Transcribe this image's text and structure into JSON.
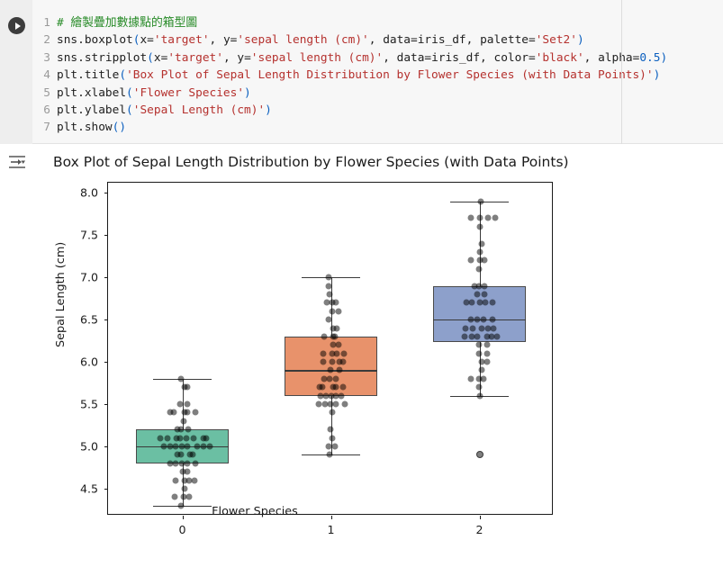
{
  "notebook": {
    "run_button_label": "run-cell",
    "output_icon_label": "output-toggle"
  },
  "code_cell": {
    "lines": [
      {
        "n": "1",
        "tokens": [
          {
            "t": "# 繪製疊加數據點的箱型圖",
            "c": "cmt"
          }
        ]
      },
      {
        "n": "2",
        "tokens": [
          {
            "t": "sns.boxplot",
            "c": "fn"
          },
          {
            "t": "(",
            "c": "par"
          },
          {
            "t": "x=",
            "c": "kw"
          },
          {
            "t": "'target'",
            "c": "str"
          },
          {
            "t": ", ",
            "c": "kw"
          },
          {
            "t": "y=",
            "c": "kw"
          },
          {
            "t": "'sepal length (cm)'",
            "c": "str"
          },
          {
            "t": ", ",
            "c": "kw"
          },
          {
            "t": "data=iris_df, ",
            "c": "kw"
          },
          {
            "t": "palette=",
            "c": "kw"
          },
          {
            "t": "'Set2'",
            "c": "str"
          },
          {
            "t": ")",
            "c": "par"
          }
        ]
      },
      {
        "n": "3",
        "tokens": [
          {
            "t": "sns.stripplot",
            "c": "fn"
          },
          {
            "t": "(",
            "c": "par"
          },
          {
            "t": "x=",
            "c": "kw"
          },
          {
            "t": "'target'",
            "c": "str"
          },
          {
            "t": ", ",
            "c": "kw"
          },
          {
            "t": "y=",
            "c": "kw"
          },
          {
            "t": "'sepal length (cm)'",
            "c": "str"
          },
          {
            "t": ", ",
            "c": "kw"
          },
          {
            "t": "data=iris_df, ",
            "c": "kw"
          },
          {
            "t": "color=",
            "c": "kw"
          },
          {
            "t": "'black'",
            "c": "str"
          },
          {
            "t": ", ",
            "c": "kw"
          },
          {
            "t": "alpha=",
            "c": "kw"
          },
          {
            "t": "0.5",
            "c": "num"
          },
          {
            "t": ")",
            "c": "par"
          }
        ]
      },
      {
        "n": "4",
        "tokens": [
          {
            "t": "plt.title",
            "c": "fn"
          },
          {
            "t": "(",
            "c": "par"
          },
          {
            "t": "'Box Plot of Sepal Length Distribution by Flower Species (with Data Points)'",
            "c": "str"
          },
          {
            "t": ")",
            "c": "par"
          }
        ]
      },
      {
        "n": "5",
        "tokens": [
          {
            "t": "plt.xlabel",
            "c": "fn"
          },
          {
            "t": "(",
            "c": "par"
          },
          {
            "t": "'Flower Species'",
            "c": "str"
          },
          {
            "t": ")",
            "c": "par"
          }
        ]
      },
      {
        "n": "6",
        "tokens": [
          {
            "t": "plt.ylabel",
            "c": "fn"
          },
          {
            "t": "(",
            "c": "par"
          },
          {
            "t": "'Sepal Length (cm)'",
            "c": "str"
          },
          {
            "t": ")",
            "c": "par"
          }
        ]
      },
      {
        "n": "7",
        "tokens": [
          {
            "t": "plt.show",
            "c": "fn"
          },
          {
            "t": "()",
            "c": "par"
          }
        ]
      }
    ]
  },
  "chart_data": {
    "type": "box",
    "title": "Box Plot of Sepal Length Distribution by Flower Species (with Data Points)",
    "xlabel": "Flower Species",
    "ylabel": "Sepal Length (cm)",
    "categories": [
      "0",
      "1",
      "2"
    ],
    "xtick_labels": [
      "0",
      "1",
      "2"
    ],
    "ytick_labels": [
      "8.0",
      "7.5",
      "7.0",
      "6.5",
      "6.0",
      "5.5",
      "5.0",
      "4.5"
    ],
    "ytick_values": [
      8.0,
      7.5,
      7.0,
      6.5,
      6.0,
      5.5,
      5.0,
      4.5
    ],
    "ylim": [
      4.18,
      8.12
    ],
    "grid": false,
    "legend": null,
    "colors": [
      "#6bbfa3",
      "#e8926b",
      "#8da0cb"
    ],
    "overlay": {
      "kind": "stripplot",
      "color": "#000000",
      "alpha": 0.5
    },
    "boxes": [
      {
        "category": "0",
        "color": "#6bbfa3",
        "q1": 4.8,
        "median": 5.0,
        "q3": 5.2,
        "whisker_low": 4.3,
        "whisker_high": 5.8,
        "fliers": [],
        "points": [
          5.1,
          4.9,
          4.7,
          4.6,
          5.0,
          5.4,
          4.6,
          5.0,
          4.4,
          4.9,
          5.4,
          4.8,
          4.8,
          4.3,
          5.8,
          5.7,
          5.4,
          5.1,
          5.7,
          5.1,
          5.4,
          5.1,
          4.6,
          5.1,
          4.8,
          5.0,
          5.0,
          5.2,
          5.2,
          4.7,
          4.8,
          5.4,
          5.2,
          5.5,
          4.9,
          5.0,
          5.5,
          4.9,
          4.4,
          5.1,
          5.0,
          4.5,
          4.4,
          5.0,
          5.1,
          4.8,
          5.1,
          4.6,
          5.3,
          5.0
        ]
      },
      {
        "category": "1",
        "color": "#e8926b",
        "q1": 5.6,
        "median": 5.9,
        "q3": 6.3,
        "whisker_low": 4.9,
        "whisker_high": 7.0,
        "fliers": [],
        "points": [
          7.0,
          6.4,
          6.9,
          5.5,
          6.5,
          5.7,
          6.3,
          4.9,
          6.6,
          5.2,
          5.0,
          5.9,
          6.0,
          6.1,
          5.6,
          6.7,
          5.6,
          5.8,
          6.2,
          5.6,
          5.9,
          6.1,
          6.3,
          6.1,
          6.4,
          6.6,
          6.8,
          6.7,
          6.0,
          5.7,
          5.5,
          5.5,
          5.8,
          6.0,
          5.4,
          6.0,
          6.7,
          6.3,
          5.6,
          5.5,
          5.5,
          6.1,
          5.8,
          5.0,
          5.6,
          5.7,
          5.7,
          6.2,
          5.1,
          5.7
        ]
      },
      {
        "category": "2",
        "color": "#8da0cb",
        "q1": 6.23,
        "median": 6.5,
        "q3": 6.9,
        "whisker_low": 5.6,
        "whisker_high": 7.9,
        "fliers": [
          4.9
        ],
        "points": [
          6.3,
          5.8,
          7.1,
          6.3,
          6.5,
          7.6,
          4.9,
          7.3,
          6.7,
          7.2,
          6.5,
          6.4,
          6.8,
          5.7,
          5.8,
          6.4,
          6.5,
          7.7,
          7.7,
          6.0,
          6.9,
          5.6,
          7.7,
          6.3,
          6.7,
          7.2,
          6.2,
          6.1,
          6.4,
          7.2,
          7.4,
          7.9,
          6.4,
          6.3,
          6.1,
          7.7,
          6.3,
          6.4,
          6.0,
          6.9,
          6.7,
          6.9,
          5.8,
          6.8,
          6.7,
          6.7,
          6.3,
          6.5,
          6.2,
          5.9
        ]
      }
    ]
  }
}
